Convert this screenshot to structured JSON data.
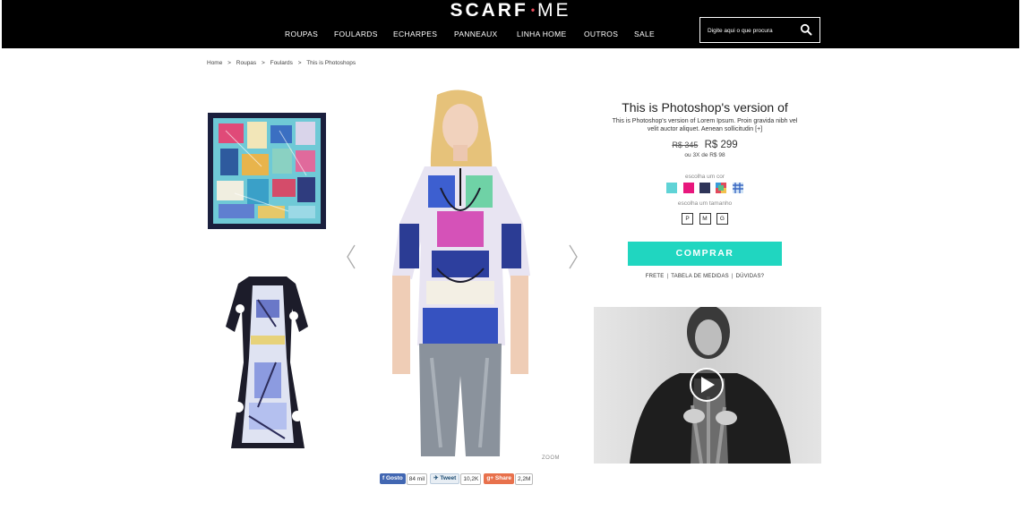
{
  "brand": {
    "name_left": "SCARF",
    "dot": "•",
    "name_right": "ME"
  },
  "nav": {
    "items": [
      {
        "label": "ROUPAS"
      },
      {
        "label": "FOULARDS"
      },
      {
        "label": "ECHARPES"
      },
      {
        "label": "PANNEAUX"
      },
      {
        "label": "LINHA HOME"
      },
      {
        "label": "OUTROS"
      },
      {
        "label": "SALE"
      }
    ]
  },
  "search": {
    "placeholder": "Digite aqui o que procura",
    "icon": "search-icon"
  },
  "breadcrumb": {
    "sep": ">",
    "items": [
      "Home",
      "Roupas",
      "Foulards",
      "This is Photoshops"
    ]
  },
  "gallery": {
    "prev_icon": "chevron-left-icon",
    "next_icon": "chevron-right-icon",
    "zoom_label": "ZOOM"
  },
  "product": {
    "title": "This is Photoshop's version  of",
    "description": "This is Photoshop's version  of Lorem Ipsum. Proin gravida nibh vel velit auctor aliquet. Aenean sollicitudin [+]",
    "old_price": "R$ 345",
    "price": "R$ 299",
    "installments": "ou 3X de R$ 98",
    "color_label": "escolha um cor",
    "colors": [
      "#5fd3d6",
      "#e8177d",
      "#2e3458",
      "pattern-multicolor",
      "pattern-blue"
    ],
    "size_label": "escolha um tamanho",
    "sizes": [
      "P",
      "M",
      "G"
    ],
    "buy_label": "COMPRAR",
    "links": [
      "FRETE",
      "TABELA DE MEDIDAS",
      "DÚVIDAS?"
    ],
    "link_sep": "|"
  },
  "video": {
    "play_icon": "play-icon"
  },
  "share": {
    "facebook_label": "Gosto",
    "facebook_count": "84 mil",
    "twitter_label": "Tweet",
    "twitter_count": "10,2K",
    "share_label": "Share",
    "share_count": "2,2M"
  },
  "colors": {
    "accent": "#20d6c0",
    "header_bg": "#000000",
    "logo_dot": "#e84b5b"
  }
}
